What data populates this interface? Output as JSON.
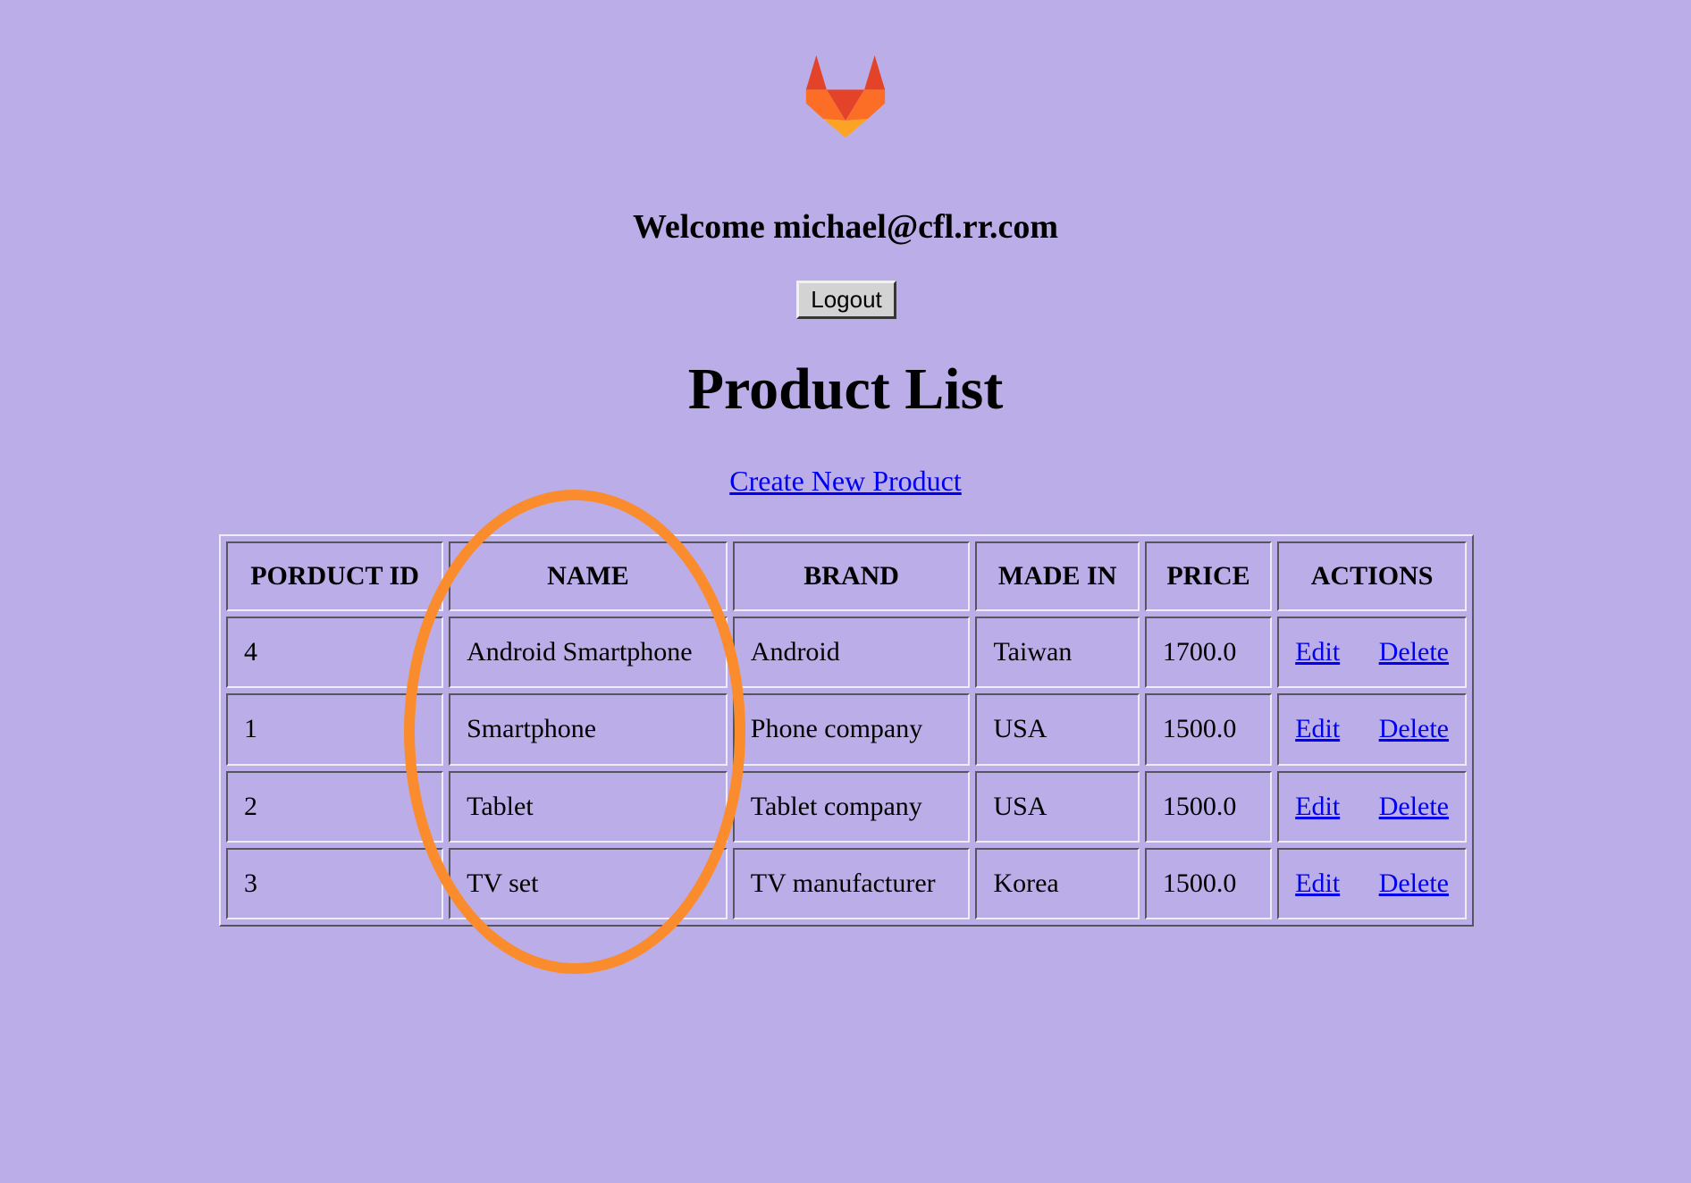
{
  "logo": {
    "icon": "gitlab-fox-icon",
    "colors": {
      "dark": "#e24329",
      "mid": "#fc6d26",
      "light": "#fca326"
    }
  },
  "header": {
    "welcome_text": "Welcome michael@cfl.rr.com",
    "logout_label": "Logout"
  },
  "page": {
    "title": "Product List",
    "create_link_label": "Create New Product"
  },
  "table": {
    "columns": [
      "PORDUCT ID",
      "NAME",
      "BRAND",
      "MADE IN",
      "PRICE",
      "ACTIONS"
    ],
    "rows": [
      {
        "id": "4",
        "name": "Android Smartphone",
        "brand": "Android",
        "made_in": "Taiwan",
        "price": "1700.0",
        "edit_label": "Edit",
        "delete_label": "Delete"
      },
      {
        "id": "1",
        "name": "Smartphone",
        "brand": "Phone company",
        "made_in": "USA",
        "price": "1500.0",
        "edit_label": "Edit",
        "delete_label": "Delete"
      },
      {
        "id": "2",
        "name": "Tablet",
        "brand": "Tablet company",
        "made_in": "USA",
        "price": "1500.0",
        "edit_label": "Edit",
        "delete_label": "Delete"
      },
      {
        "id": "3",
        "name": "TV set",
        "brand": "TV manufacturer",
        "made_in": "Korea",
        "price": "1500.0",
        "edit_label": "Edit",
        "delete_label": "Delete"
      }
    ]
  },
  "annotation": {
    "shape": "ellipse",
    "color": "#fa8c2d"
  },
  "colors": {
    "background": "#bbaee8",
    "link": "#0000ee"
  }
}
